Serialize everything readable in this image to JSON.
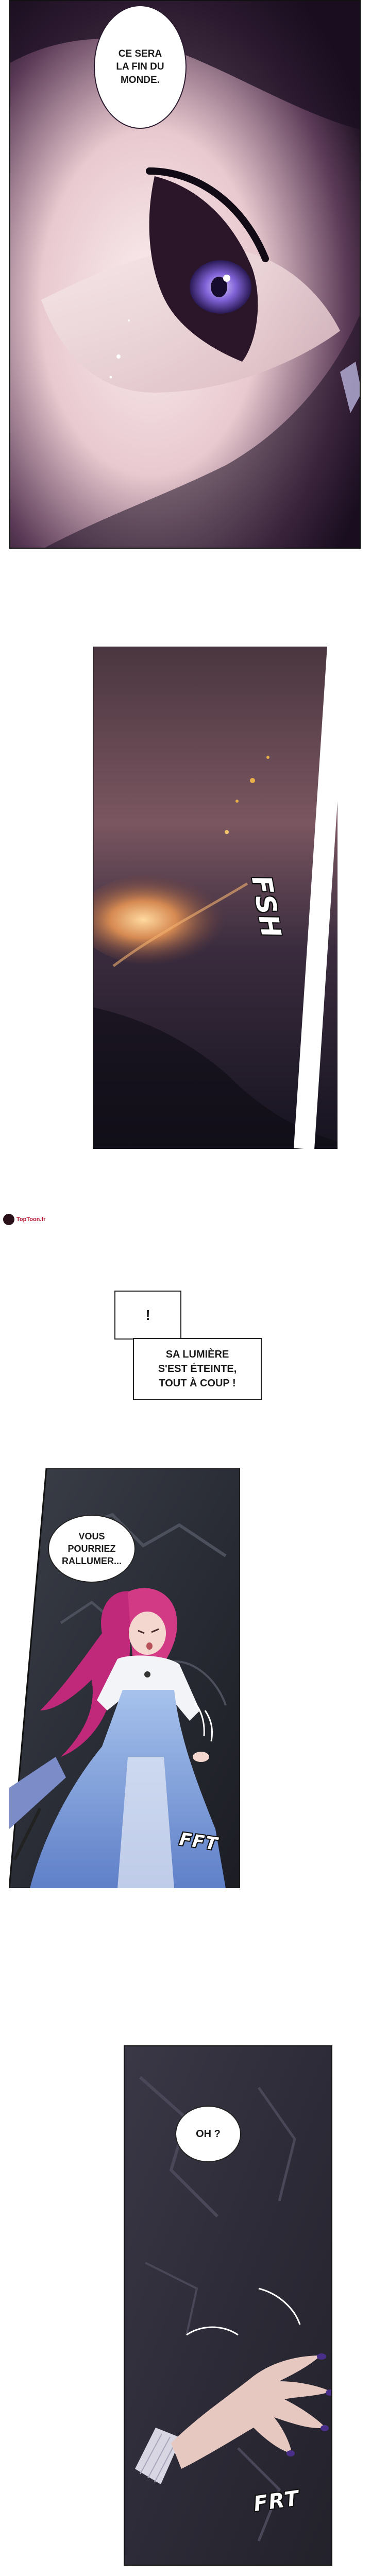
{
  "panel1": {
    "bubble_text": "CE SERA\nLA FIN DU\nMONDE."
  },
  "panel2": {
    "sfx": "FSH"
  },
  "watermark": {
    "text": "TopToon.fr"
  },
  "narration": {
    "exclaim": "!",
    "text": "SA LUMIÈRE\nS'EST ÉTEINTE,\nTOUT À COUP !"
  },
  "panel3": {
    "bubble_text": "VOUS\nPOURRIEZ\nRALLUMER...",
    "sfx": "FFT"
  },
  "panel4": {
    "bubble_text": "OH ?",
    "sfx": "FRT"
  }
}
